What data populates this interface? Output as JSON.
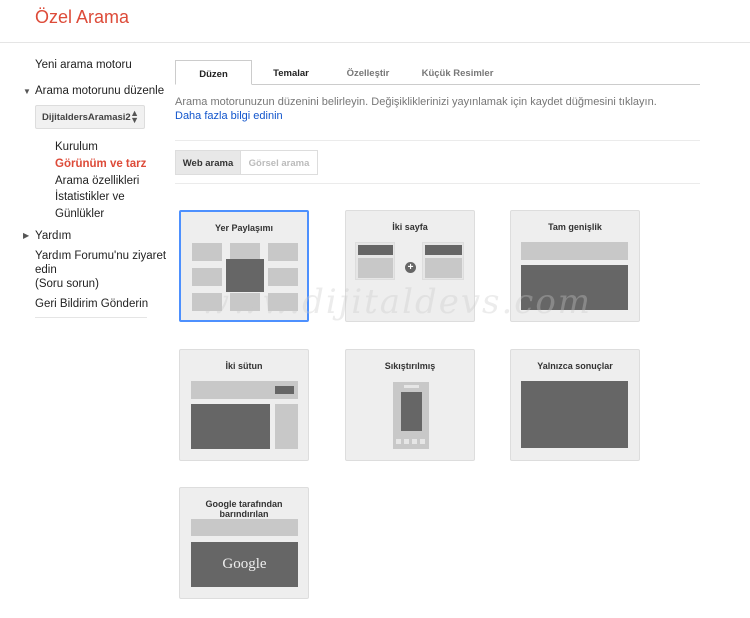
{
  "header": {
    "title": "Özel Arama"
  },
  "sidebar": {
    "new_engine": "Yeni arama motoru",
    "edit_engine": "Arama motorunu düzenle",
    "engine_select": "DijitaldersAramasi2",
    "sub_items": [
      {
        "label": "Kurulum",
        "active": false
      },
      {
        "label": "Görünüm ve tarz",
        "active": true
      },
      {
        "label": "Arama özellikleri",
        "active": false
      },
      {
        "label": "İstatistikler ve",
        "active": false
      },
      {
        "label": "Günlükler",
        "active": false
      }
    ],
    "help": "Yardım",
    "forum_line1": "Yardım Forumu'nu ziyaret",
    "forum_line2": "edin",
    "forum_line3": "(Soru sorun)",
    "feedback": "Geri Bildirim Gönderin"
  },
  "tabs": [
    {
      "label": "Düzen",
      "active": true
    },
    {
      "label": "Temalar"
    },
    {
      "label": "Özelleştir"
    },
    {
      "label": "Küçük Resimler"
    }
  ],
  "description": "Arama motorunuzun düzenini belirleyin. Değişikliklerinizi yayınlamak için kaydet düğmesini tıklayın.",
  "learn_more": "Daha fazla bilgi edinin",
  "segments": {
    "web": "Web arama",
    "image": "Görsel arama"
  },
  "layouts": [
    {
      "label": "Yer Paylaşımı",
      "selected": true
    },
    {
      "label": "İki sayfa"
    },
    {
      "label": "Tam genişlik"
    },
    {
      "label": "İki sütun"
    },
    {
      "label": "Sıkıştırılmış"
    },
    {
      "label": "Yalnızca sonuçlar"
    },
    {
      "label": "Google tarafından barındırılan",
      "preview_logo": "Google"
    }
  ],
  "watermark": "www.dijitaldevs.com",
  "colors": {
    "accent": "#dd4b39",
    "link": "#1155cc",
    "selected_border": "#4d90fe"
  }
}
